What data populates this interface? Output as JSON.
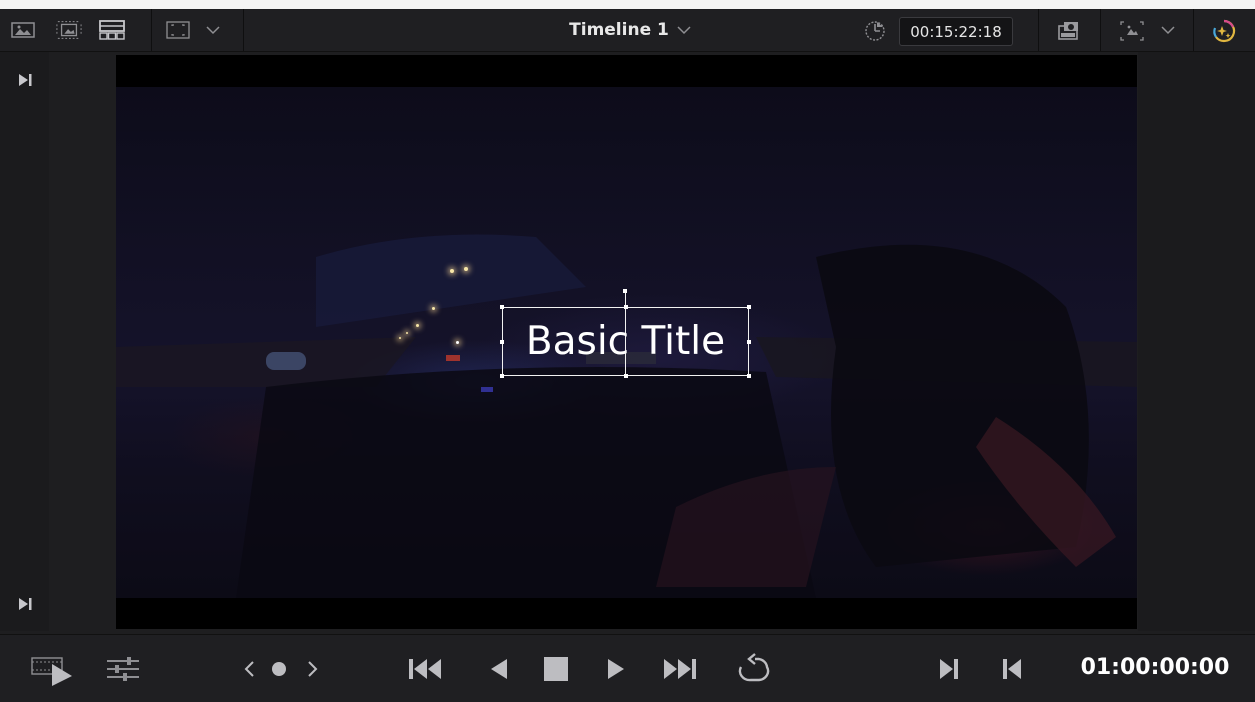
{
  "header": {
    "timeline_title": "Timeline 1",
    "source_timecode": "00:15:22:18"
  },
  "viewer": {
    "overlay_title": "Basic Title"
  },
  "transport": {
    "record_timecode": "01:00:00:00"
  },
  "icons": {
    "top_left": [
      "image-viewer-icon",
      "clip-viewer-icon",
      "layout-icon",
      "fullscreen-icon",
      "chevron-down-icon"
    ],
    "top_right": [
      "timecode-clock-icon",
      "camera-icon",
      "transform-icon",
      "chevron-down-icon",
      "effects-icon"
    ],
    "left_rail": [
      "mark-in-icon",
      "mark-out-icon"
    ],
    "bottom": [
      "clip-play-icon",
      "sliders-icon",
      "prev-keyframe-icon",
      "keyframe-dot-icon",
      "next-keyframe-icon",
      "go-to-start-icon",
      "play-reverse-icon",
      "stop-icon",
      "play-icon",
      "go-to-end-icon",
      "loop-icon",
      "mark-in-icon",
      "mark-out-icon"
    ]
  },
  "colors": {
    "background": "#1e1e20",
    "viewer": "#000000",
    "text": "#e8e8e8"
  }
}
